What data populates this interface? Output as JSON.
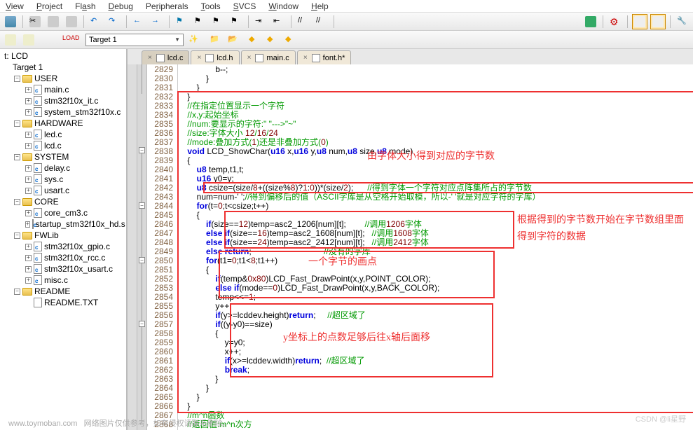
{
  "menu": [
    "View",
    "Project",
    "Flash",
    "Debug",
    "Peripherals",
    "Tools",
    "SVCS",
    "Window",
    "Help"
  ],
  "menuAccess": [
    "V",
    "P",
    "F",
    "D",
    "",
    "T",
    "S",
    "W",
    "H"
  ],
  "target": {
    "label": "Target 1"
  },
  "tree": {
    "root": "t: LCD",
    "target": "Target 1",
    "groups": [
      {
        "name": "USER",
        "files": [
          "main.c",
          "stm32f10x_it.c",
          "system_stm32f10x.c"
        ]
      },
      {
        "name": "HARDWARE",
        "files": [
          "led.c",
          "lcd.c"
        ]
      },
      {
        "name": "SYSTEM",
        "files": [
          "delay.c",
          "sys.c",
          "usart.c"
        ]
      },
      {
        "name": "CORE",
        "files": [
          "core_cm3.c",
          "startup_stm32f10x_hd.s"
        ]
      },
      {
        "name": "FWLib",
        "files": [
          "stm32f10x_gpio.c",
          "stm32f10x_rcc.c",
          "stm32f10x_usart.c",
          "misc.c"
        ]
      },
      {
        "name": "README",
        "files": [
          "README.TXT"
        ]
      }
    ]
  },
  "tabs": [
    {
      "label": "lcd.c",
      "active": true
    },
    {
      "label": "lcd.h",
      "active": false
    },
    {
      "label": "main.c",
      "active": false
    },
    {
      "label": "font.h*",
      "active": false
    }
  ],
  "code": {
    "start": 2829,
    "lines": [
      "                b--;",
      "            }",
      "        }",
      "    }",
      "    //在指定位置显示一个字符",
      "    //x,y:起始坐标",
      "    //num:要显示的字符:\" \"--->\"~\"",
      "    //size:字体大小 12/16/24",
      "    //mode:叠加方式(1)还是非叠加方式(0)",
      "    void LCD_ShowChar(u16 x,u16 y,u8 num,u8 size,u8 mode)",
      "    {",
      "        u8 temp,t1,t;",
      "        u16 y0=y;",
      "        u8 csize=(size/8+((size%8)?1:0))*(size/2);      //得到字体一个字符对应点阵集所占的字节数",
      "        num=num-' ';//得到偏移后的值（ASCII字库是从空格开始取模，所以-' '就是对应字符的字库）",
      "        for(t=0;t<csize;t++)",
      "        {",
      "            if(size==12)temp=asc2_1206[num][t];        //调用1206字体",
      "            else if(size==16)temp=asc2_1608[num][t];   //调用1608字体",
      "            else if(size==24)temp=asc2_2412[num][t];   //调用2412字体",
      "            else return;                               //没有的字库",
      "            for(t1=0;t1<8;t1++)",
      "            {",
      "                if(temp&0x80)LCD_Fast_DrawPoint(x,y,POINT_COLOR);",
      "                else if(mode==0)LCD_Fast_DrawPoint(x,y,BACK_COLOR);",
      "                temp<<=1;",
      "                y++;",
      "                if(y>=lcddev.height)return;     //超区域了",
      "                if((y-y0)==size)",
      "                {",
      "                    y=y0;",
      "                    x++;",
      "                    if(x>=lcddev.width)return;  //超区域了",
      "                    break;",
      "                }",
      "            }",
      "        }",
      "    }",
      "    //m^n函数",
      "    //返回值:m^n次方"
    ]
  },
  "annotations": {
    "a1": "由字体大小得到对应的字节数",
    "a2": "根据得到的字节数开始在字节数组里面",
    "a3": "得到字符的数据",
    "a4": "一个字节的画点",
    "a5": "y坐标上的点数足够后往x轴后面移"
  },
  "footer": {
    "url": "www.toymoban.com",
    "note": "网络图片仅供参考，如有侵权请联系删除。"
  },
  "watermark": "CSDN @li星野"
}
